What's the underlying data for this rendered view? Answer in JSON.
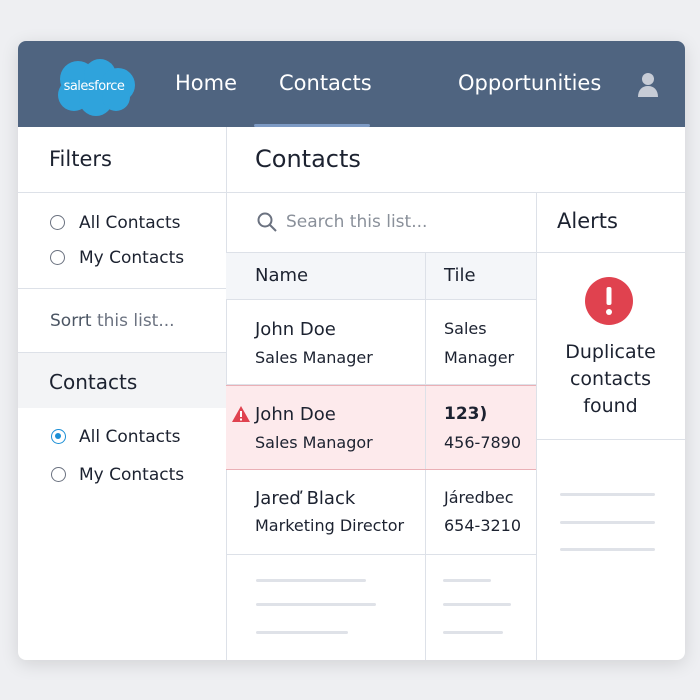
{
  "header": {
    "logo": "salesforce",
    "nav": [
      "Home",
      "Contacts",
      "Opportunities"
    ],
    "active": "Contacts"
  },
  "sidebar": {
    "filters_title": "Filters",
    "filters": [
      "All Contacts",
      "My Contacts"
    ],
    "sort_prefix": "Sorrt",
    "sort_rest": " this list...",
    "contacts_title": "Contacts",
    "contacts": [
      "All Contacts",
      "My Contacts"
    ],
    "selected": "All Contacts"
  },
  "main": {
    "title": "Contacts",
    "search_placeholder": "Search this list...",
    "columns": [
      "Name",
      "Tile"
    ],
    "rows": [
      {
        "name": "John Doe",
        "role": "Sales Manager",
        "c1": "Sales",
        "c2": "Manager",
        "flag": false
      },
      {
        "name": "John Doe",
        "role": "Sales Managor",
        "c1": "123)",
        "c2": "456-7890",
        "flag": true
      },
      {
        "name": "Jareď Black",
        "role": "Marketing Director",
        "c1": "Járedbec",
        "c2": "654-3210",
        "flag": false
      }
    ]
  },
  "alerts": {
    "title": "Alerts",
    "message_lines": [
      "Duplicate",
      "contacts",
      "found"
    ]
  },
  "colors": {
    "header": "#4f6480",
    "brand": "#1b9ad6",
    "alert": "#e0424f",
    "dup_row": "#fdeaec"
  }
}
